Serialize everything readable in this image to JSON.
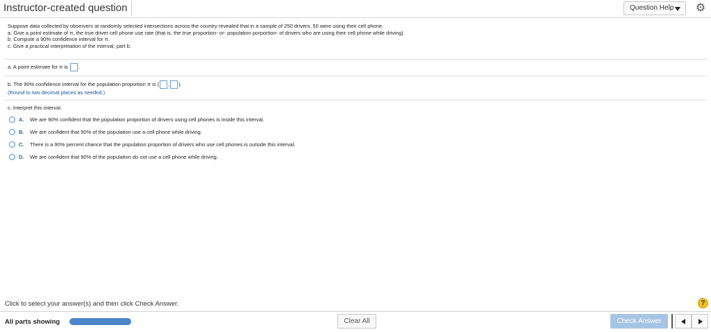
{
  "header": {
    "title": "Instructor-created question",
    "help_label": "Question Help"
  },
  "problem": {
    "lines": [
      "Suppose data collected by observers at randomly selected intersections across the country revealed that in a sample of 250 drivers, 50 were using their cell phone.",
      "a. Give a point estimate of π, the true driver cell phone use rate (that is, the true proportion- or- population porportion- of drivers who are using their cell phone while driving).",
      "b. Compute a 90% confidence interval for π.",
      "c. Give a practical interpretation of the interval, part b."
    ]
  },
  "part_a": {
    "prefix": "a. A point estimate for π is",
    "suffix": "."
  },
  "part_b": {
    "prefix": "b. The 90% confidence interval for the population proportion π is (",
    "separator": ",",
    "suffix": ").",
    "note": "(Round to two decimal places as needed.)"
  },
  "part_c": {
    "prompt": "c. Interpret this interval.",
    "options": [
      {
        "letter": "A.",
        "text": "We are 90% confident that the population proportion of drivers using cell phones is inside this interval."
      },
      {
        "letter": "B.",
        "text": "We are confident that 90% of the population use a cell phone while driving."
      },
      {
        "letter": "C.",
        "text": "There is a 90% percent chance that the population proportion of drivers who use cell phones is outside this interval."
      },
      {
        "letter": "D.",
        "text": "We are confident that 90% of the population do not use a cell phone while driving."
      }
    ]
  },
  "footer": {
    "hint": "Click to select your answer(s) and then click Check Answer.",
    "parts_label": "All parts showing",
    "clear_label": "Clear All",
    "check_label": "Check Answer",
    "help_glyph": "?"
  },
  "colors": {
    "accent": "#4a86c8",
    "check_button": "#a6c4e4",
    "link_blue": "#1b4e9c"
  },
  "icons": {
    "settings": "gear-icon",
    "dropdown": "caret-down-icon",
    "prev": "arrow-left-icon",
    "next": "arrow-right-icon",
    "help": "question-mark-icon"
  }
}
